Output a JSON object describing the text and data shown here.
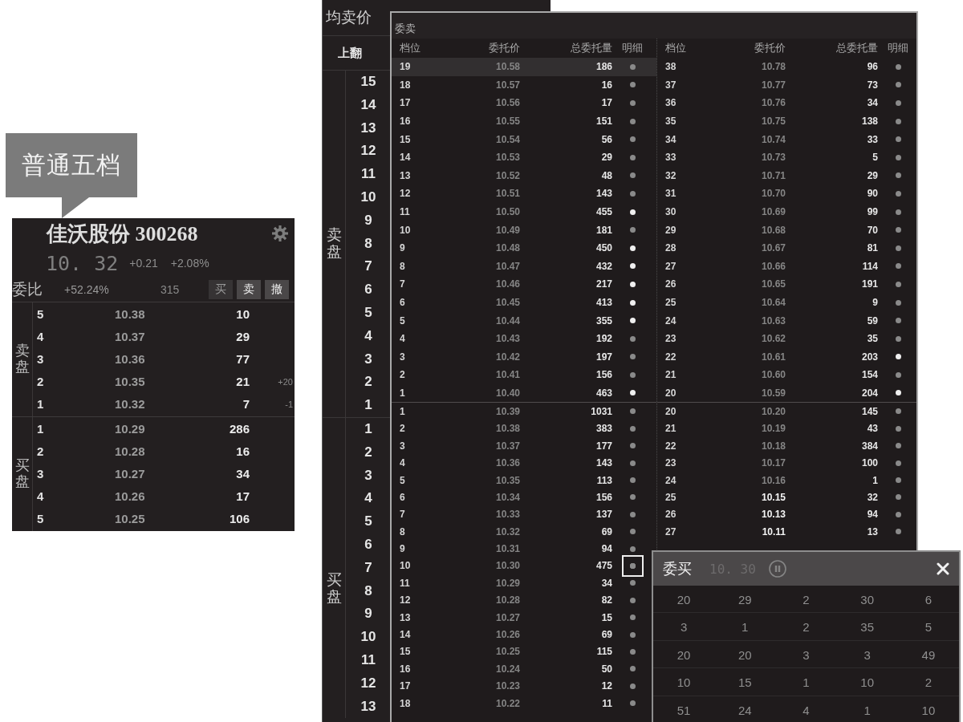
{
  "callout": {
    "text": "普通五档"
  },
  "quote_panel": {
    "title": "佳沃股份 300268",
    "price": "10. 32",
    "change": "+0.21",
    "change_percent": "+2.08%",
    "ratio_label": "委比",
    "ratio": "+52.24%",
    "ratio_volume": "315",
    "actions": [
      {
        "label": "买",
        "disabled": true
      },
      {
        "label": "卖",
        "disabled": false
      },
      {
        "label": "撤",
        "disabled": false
      }
    ],
    "sell_label": "卖盘",
    "sell": [
      {
        "tier": "5",
        "price": "10.38",
        "volume": "10"
      },
      {
        "tier": "4",
        "price": "10.37",
        "volume": "29"
      },
      {
        "tier": "3",
        "price": "10.36",
        "volume": "77"
      },
      {
        "tier": "2",
        "price": "10.35",
        "volume": "21",
        "change": "+20"
      },
      {
        "tier": "1",
        "price": "10.32",
        "volume": "7",
        "change": "-1"
      }
    ],
    "buy_label": "买盘",
    "buy": [
      {
        "tier": "1",
        "price": "10.29",
        "volume": "286"
      },
      {
        "tier": "2",
        "price": "10.28",
        "volume": "16"
      },
      {
        "tier": "3",
        "price": "10.27",
        "volume": "34"
      },
      {
        "tier": "4",
        "price": "10.26",
        "volume": "17"
      },
      {
        "tier": "5",
        "price": "10.25",
        "volume": "106"
      }
    ]
  },
  "depth_panel": {
    "header": "均卖价",
    "page_up": "上翻",
    "sell_label": "卖盘",
    "sell_tiers": [
      "15",
      "14",
      "13",
      "12",
      "11",
      "10",
      "9",
      "8",
      "7",
      "6",
      "5",
      "4",
      "3",
      "2",
      "1"
    ],
    "buy_label": "买盘",
    "buy_tiers": [
      "1",
      "2",
      "3",
      "4",
      "5",
      "6",
      "7",
      "8",
      "9",
      "10",
      "11",
      "12",
      "13"
    ]
  },
  "order_window": {
    "title": "委卖",
    "halves": [
      {
        "columns": [
          "档位",
          "委托价",
          "总委托量",
          "明细"
        ],
        "sell": [
          {
            "tier": "19",
            "price": "10.58",
            "volume": "186",
            "highlighted": false,
            "emphasized": false,
            "selected": true,
            "detail_open": false
          },
          {
            "tier": "18",
            "price": "10.57",
            "volume": "16",
            "highlighted": false,
            "emphasized": false,
            "selected": false,
            "detail_open": false
          },
          {
            "tier": "17",
            "price": "10.56",
            "volume": "17",
            "highlighted": false,
            "emphasized": false,
            "selected": false,
            "detail_open": false
          },
          {
            "tier": "16",
            "price": "10.55",
            "volume": "151",
            "highlighted": false,
            "emphasized": false,
            "selected": false,
            "detail_open": false
          },
          {
            "tier": "15",
            "price": "10.54",
            "volume": "56",
            "highlighted": false,
            "emphasized": false,
            "selected": false,
            "detail_open": false
          },
          {
            "tier": "14",
            "price": "10.53",
            "volume": "29",
            "highlighted": false,
            "emphasized": false,
            "selected": false,
            "detail_open": false
          },
          {
            "tier": "13",
            "price": "10.52",
            "volume": "48",
            "highlighted": false,
            "emphasized": false,
            "selected": false,
            "detail_open": false
          },
          {
            "tier": "12",
            "price": "10.51",
            "volume": "143",
            "highlighted": false,
            "emphasized": false,
            "selected": false,
            "detail_open": false
          },
          {
            "tier": "11",
            "price": "10.50",
            "volume": "455",
            "highlighted": true,
            "emphasized": false,
            "selected": false,
            "detail_open": false
          },
          {
            "tier": "10",
            "price": "10.49",
            "volume": "181",
            "highlighted": false,
            "emphasized": false,
            "selected": false,
            "detail_open": false
          },
          {
            "tier": "9",
            "price": "10.48",
            "volume": "450",
            "highlighted": true,
            "emphasized": false,
            "selected": false,
            "detail_open": false
          },
          {
            "tier": "8",
            "price": "10.47",
            "volume": "432",
            "highlighted": true,
            "emphasized": false,
            "selected": false,
            "detail_open": false
          },
          {
            "tier": "7",
            "price": "10.46",
            "volume": "217",
            "highlighted": true,
            "emphasized": false,
            "selected": false,
            "detail_open": false
          },
          {
            "tier": "6",
            "price": "10.45",
            "volume": "413",
            "highlighted": true,
            "emphasized": false,
            "selected": false,
            "detail_open": false
          },
          {
            "tier": "5",
            "price": "10.44",
            "volume": "355",
            "highlighted": true,
            "emphasized": false,
            "selected": false,
            "detail_open": false
          },
          {
            "tier": "4",
            "price": "10.43",
            "volume": "192",
            "highlighted": false,
            "emphasized": false,
            "selected": false,
            "detail_open": false
          },
          {
            "tier": "3",
            "price": "10.42",
            "volume": "197",
            "highlighted": false,
            "emphasized": false,
            "selected": false,
            "detail_open": false
          },
          {
            "tier": "2",
            "price": "10.41",
            "volume": "156",
            "highlighted": false,
            "emphasized": false,
            "selected": false,
            "detail_open": false
          },
          {
            "tier": "1",
            "price": "10.40",
            "volume": "463",
            "highlighted": true,
            "emphasized": false,
            "selected": false,
            "detail_open": false
          }
        ],
        "buy": [
          {
            "tier": "1",
            "price": "10.39",
            "volume": "1031",
            "highlighted": false,
            "emphasized": false,
            "selected": false,
            "detail_open": false
          },
          {
            "tier": "2",
            "price": "10.38",
            "volume": "383",
            "highlighted": false,
            "emphasized": false,
            "selected": false,
            "detail_open": false
          },
          {
            "tier": "3",
            "price": "10.37",
            "volume": "177",
            "highlighted": false,
            "emphasized": false,
            "selected": false,
            "detail_open": false
          },
          {
            "tier": "4",
            "price": "10.36",
            "volume": "143",
            "highlighted": false,
            "emphasized": false,
            "selected": false,
            "detail_open": false
          },
          {
            "tier": "5",
            "price": "10.35",
            "volume": "113",
            "highlighted": false,
            "emphasized": false,
            "selected": false,
            "detail_open": false
          },
          {
            "tier": "6",
            "price": "10.34",
            "volume": "156",
            "highlighted": false,
            "emphasized": false,
            "selected": false,
            "detail_open": false
          },
          {
            "tier": "7",
            "price": "10.33",
            "volume": "137",
            "highlighted": false,
            "emphasized": false,
            "selected": false,
            "detail_open": false
          },
          {
            "tier": "8",
            "price": "10.32",
            "volume": "69",
            "highlighted": false,
            "emphasized": false,
            "selected": false,
            "detail_open": false
          },
          {
            "tier": "9",
            "price": "10.31",
            "volume": "94",
            "highlighted": false,
            "emphasized": false,
            "selected": false,
            "detail_open": false
          },
          {
            "tier": "10",
            "price": "10.30",
            "volume": "475",
            "highlighted": false,
            "emphasized": false,
            "selected": false,
            "detail_open": true
          },
          {
            "tier": "11",
            "price": "10.29",
            "volume": "34",
            "highlighted": false,
            "emphasized": false,
            "selected": false,
            "detail_open": false
          },
          {
            "tier": "12",
            "price": "10.28",
            "volume": "82",
            "highlighted": false,
            "emphasized": false,
            "selected": false,
            "detail_open": false
          },
          {
            "tier": "13",
            "price": "10.27",
            "volume": "15",
            "highlighted": false,
            "emphasized": false,
            "selected": false,
            "detail_open": false
          },
          {
            "tier": "14",
            "price": "10.26",
            "volume": "69",
            "highlighted": false,
            "emphasized": false,
            "selected": false,
            "detail_open": false
          },
          {
            "tier": "15",
            "price": "10.25",
            "volume": "115",
            "highlighted": false,
            "emphasized": false,
            "selected": false,
            "detail_open": false
          },
          {
            "tier": "16",
            "price": "10.24",
            "volume": "50",
            "highlighted": false,
            "emphasized": false,
            "selected": false,
            "detail_open": false
          },
          {
            "tier": "17",
            "price": "10.23",
            "volume": "12",
            "highlighted": false,
            "emphasized": false,
            "selected": false,
            "detail_open": false
          },
          {
            "tier": "18",
            "price": "10.22",
            "volume": "11",
            "highlighted": false,
            "emphasized": false,
            "selected": false,
            "detail_open": false
          }
        ]
      },
      {
        "columns": [
          "档位",
          "委托价",
          "总委托量",
          "明细"
        ],
        "sell": [
          {
            "tier": "38",
            "price": "10.78",
            "volume": "96",
            "highlighted": false,
            "emphasized": false,
            "selected": false,
            "detail_open": false
          },
          {
            "tier": "37",
            "price": "10.77",
            "volume": "73",
            "highlighted": false,
            "emphasized": false,
            "selected": false,
            "detail_open": false
          },
          {
            "tier": "36",
            "price": "10.76",
            "volume": "34",
            "highlighted": false,
            "emphasized": false,
            "selected": false,
            "detail_open": false
          },
          {
            "tier": "35",
            "price": "10.75",
            "volume": "138",
            "highlighted": false,
            "emphasized": false,
            "selected": false,
            "detail_open": false
          },
          {
            "tier": "34",
            "price": "10.74",
            "volume": "33",
            "highlighted": false,
            "emphasized": false,
            "selected": false,
            "detail_open": false
          },
          {
            "tier": "33",
            "price": "10.73",
            "volume": "5",
            "highlighted": false,
            "emphasized": false,
            "selected": false,
            "detail_open": false
          },
          {
            "tier": "32",
            "price": "10.71",
            "volume": "29",
            "highlighted": false,
            "emphasized": false,
            "selected": false,
            "detail_open": false
          },
          {
            "tier": "31",
            "price": "10.70",
            "volume": "90",
            "highlighted": false,
            "emphasized": false,
            "selected": false,
            "detail_open": false
          },
          {
            "tier": "30",
            "price": "10.69",
            "volume": "99",
            "highlighted": false,
            "emphasized": false,
            "selected": false,
            "detail_open": false
          },
          {
            "tier": "29",
            "price": "10.68",
            "volume": "70",
            "highlighted": false,
            "emphasized": false,
            "selected": false,
            "detail_open": false
          },
          {
            "tier": "28",
            "price": "10.67",
            "volume": "81",
            "highlighted": false,
            "emphasized": false,
            "selected": false,
            "detail_open": false
          },
          {
            "tier": "27",
            "price": "10.66",
            "volume": "114",
            "highlighted": false,
            "emphasized": false,
            "selected": false,
            "detail_open": false
          },
          {
            "tier": "26",
            "price": "10.65",
            "volume": "191",
            "highlighted": false,
            "emphasized": false,
            "selected": false,
            "detail_open": false
          },
          {
            "tier": "25",
            "price": "10.64",
            "volume": "9",
            "highlighted": false,
            "emphasized": false,
            "selected": false,
            "detail_open": false
          },
          {
            "tier": "24",
            "price": "10.63",
            "volume": "59",
            "highlighted": false,
            "emphasized": false,
            "selected": false,
            "detail_open": false
          },
          {
            "tier": "23",
            "price": "10.62",
            "volume": "35",
            "highlighted": false,
            "emphasized": false,
            "selected": false,
            "detail_open": false
          },
          {
            "tier": "22",
            "price": "10.61",
            "volume": "203",
            "highlighted": true,
            "emphasized": false,
            "selected": false,
            "detail_open": false
          },
          {
            "tier": "21",
            "price": "10.60",
            "volume": "154",
            "highlighted": false,
            "emphasized": false,
            "selected": false,
            "detail_open": false
          },
          {
            "tier": "20",
            "price": "10.59",
            "volume": "204",
            "highlighted": true,
            "emphasized": false,
            "selected": false,
            "detail_open": false
          }
        ],
        "buy": [
          {
            "tier": "20",
            "price": "10.20",
            "volume": "145",
            "highlighted": false,
            "emphasized": false,
            "selected": false,
            "detail_open": false
          },
          {
            "tier": "21",
            "price": "10.19",
            "volume": "43",
            "highlighted": false,
            "emphasized": false,
            "selected": false,
            "detail_open": false
          },
          {
            "tier": "22",
            "price": "10.18",
            "volume": "384",
            "highlighted": false,
            "emphasized": false,
            "selected": false,
            "detail_open": false
          },
          {
            "tier": "23",
            "price": "10.17",
            "volume": "100",
            "highlighted": false,
            "emphasized": false,
            "selected": false,
            "detail_open": false
          },
          {
            "tier": "24",
            "price": "10.16",
            "volume": "1",
            "highlighted": false,
            "emphasized": false,
            "selected": false,
            "detail_open": false
          },
          {
            "tier": "25",
            "price": "10.15",
            "volume": "32",
            "highlighted": false,
            "emphasized": true,
            "selected": false,
            "detail_open": false
          },
          {
            "tier": "26",
            "price": "10.13",
            "volume": "94",
            "highlighted": false,
            "emphasized": true,
            "selected": false,
            "detail_open": false
          },
          {
            "tier": "27",
            "price": "10.11",
            "volume": "13",
            "highlighted": false,
            "emphasized": true,
            "selected": false,
            "detail_open": false
          }
        ]
      }
    ]
  },
  "detail_window": {
    "title": "委买",
    "price": "10. 30",
    "rows": [
      [
        "20",
        "29",
        "2",
        "30",
        "6"
      ],
      [
        "3",
        "1",
        "2",
        "35",
        "5"
      ],
      [
        "20",
        "20",
        "3",
        "3",
        "49"
      ],
      [
        "10",
        "15",
        "1",
        "10",
        "2"
      ],
      [
        "51",
        "24",
        "4",
        "1",
        "10"
      ]
    ]
  }
}
